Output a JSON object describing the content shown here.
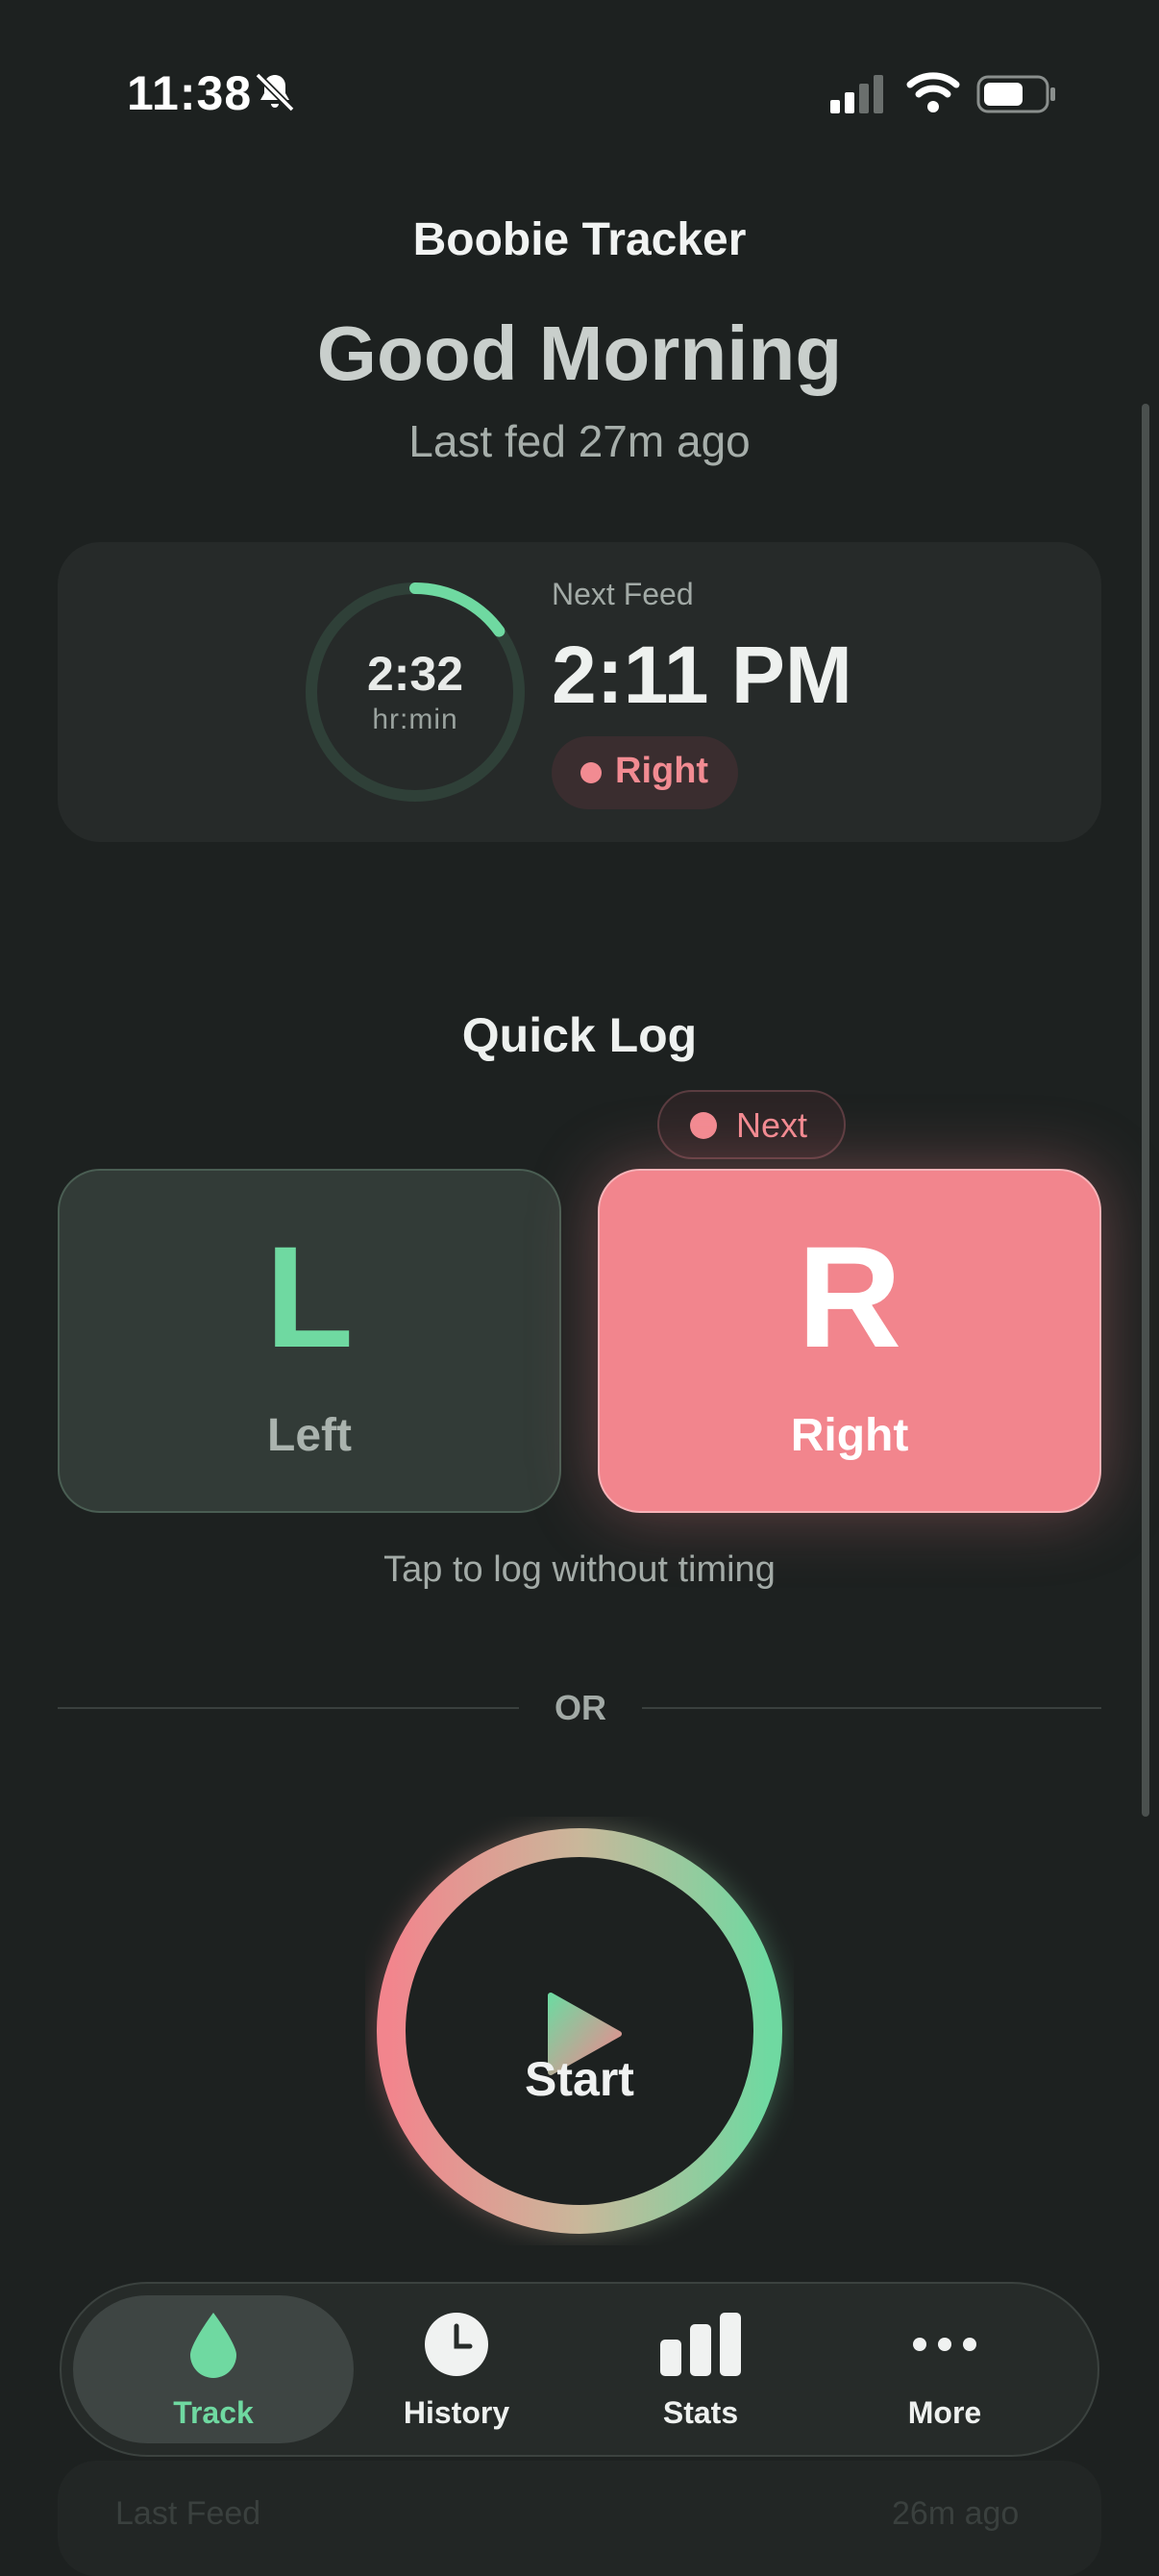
{
  "status_bar": {
    "time": "11:38"
  },
  "header": {
    "app_title": "Boobie Tracker",
    "greeting": "Good Morning",
    "last_fed": "Last fed 27m ago"
  },
  "next_feed": {
    "ring_value": "2:32",
    "ring_unit": "hr:min",
    "ring_progress": 0.15,
    "label": "Next Feed",
    "time": "2:11 PM",
    "side": "Right"
  },
  "quick_log": {
    "title": "Quick Log",
    "next_badge": "Next",
    "left": {
      "letter": "L",
      "label": "Left"
    },
    "right": {
      "letter": "R",
      "label": "Right"
    },
    "hint": "Tap to log without timing"
  },
  "divider": {
    "text": "OR"
  },
  "start": {
    "label": "Start"
  },
  "nav": {
    "items": [
      {
        "label": "Track",
        "icon": "drop-icon",
        "active": true
      },
      {
        "label": "History",
        "icon": "clock-icon"
      },
      {
        "label": "Stats",
        "icon": "bar-chart-icon"
      },
      {
        "label": "More",
        "icon": "more-dots-icon"
      }
    ]
  },
  "peek": {
    "left": "Last Feed",
    "right": "26m ago"
  },
  "colors": {
    "background": "#1d2120",
    "accent_green": "#6fd9a1",
    "accent_pink": "#f28b92",
    "card": "#262a29"
  }
}
